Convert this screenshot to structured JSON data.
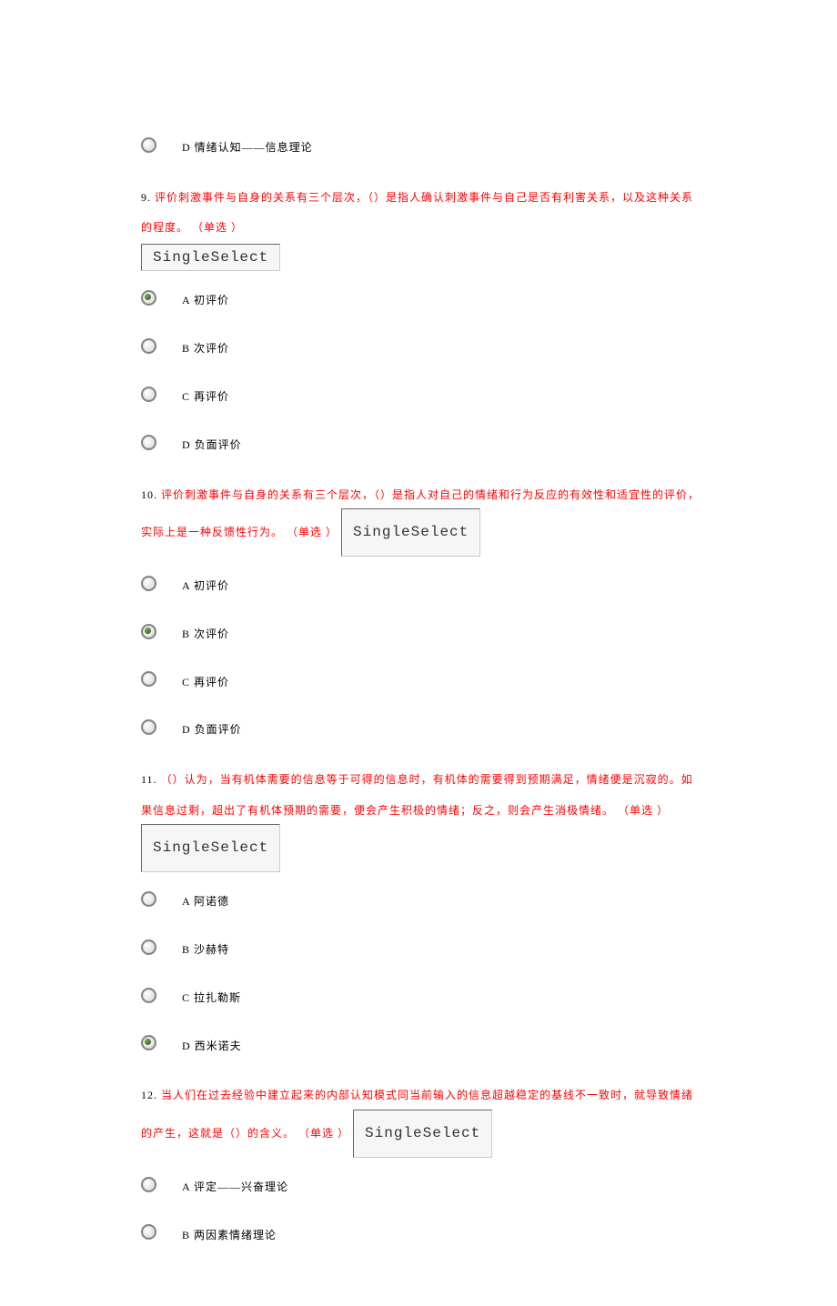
{
  "badge_label": "SingleSelect",
  "q8": {
    "options": {
      "d": "D 情绪认知——信息理论"
    }
  },
  "q9": {
    "num": "9.",
    "text": "评价刺激事件与自身的关系有三个层次，（）是指人确认刺激事件与自己是否有利害关系，以及这种关系的程度。",
    "tag": "（单选 ）",
    "options": {
      "a": "A 初评价",
      "b": "B 次评价",
      "c": "C 再评价",
      "d": "D 负面评价"
    }
  },
  "q10": {
    "num": "10.",
    "text": "评价刺激事件与自身的关系有三个层次，（）是指人对自己的情绪和行为反应的有效性和适宜性的评价，实际上是一种反馈性行为。",
    "tag": "（单选 ）",
    "options": {
      "a": "A 初评价",
      "b": "B 次评价",
      "c": "C 再评价",
      "d": "D 负面评价"
    }
  },
  "q11": {
    "num": "11.",
    "text": "（）认为，当有机体需要的信息等于可得的信息时，有机体的需要得到预期满足，情绪便是沉寂的。如果信息过剩，超出了有机体预期的需要，便会产生积极的情绪；反之，则会产生消极情绪。",
    "tag": "（单选 ）",
    "options": {
      "a": "A 阿诺德",
      "b": "B 沙赫特",
      "c": "C 拉扎勒斯",
      "d": "D 西米诺夫"
    }
  },
  "q12": {
    "num": "12.",
    "text": "当人们在过去经验中建立起来的内部认知模式同当前输入的信息超越稳定的基线不一致时，就导致情绪的产生，这就是（）的含义。",
    "tag": "（单选 ）",
    "options": {
      "a": "A 评定——兴奋理论",
      "b": "B 两因素情绪理论"
    }
  }
}
